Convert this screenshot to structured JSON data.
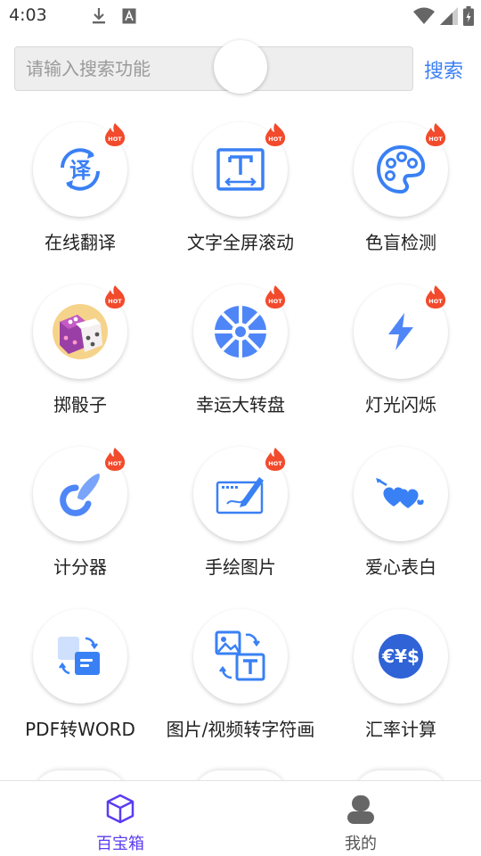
{
  "status": {
    "time": "4:03"
  },
  "search": {
    "placeholder": "请输入搜索功能",
    "button": "搜索"
  },
  "hot_badge": "HOT",
  "tools": [
    {
      "label": "在线翻译",
      "icon": "translate-icon",
      "hot": true
    },
    {
      "label": "文字全屏滚动",
      "icon": "text-frame-icon",
      "hot": true
    },
    {
      "label": "色盲检测",
      "icon": "palette-icon",
      "hot": true
    },
    {
      "label": "掷骰子",
      "icon": "dice-icon",
      "hot": true
    },
    {
      "label": "幸运大转盘",
      "icon": "wheel-icon",
      "hot": true
    },
    {
      "label": "灯光闪烁",
      "icon": "lightning-icon",
      "hot": true
    },
    {
      "label": "计分器",
      "icon": "score-icon",
      "hot": true
    },
    {
      "label": "手绘图片",
      "icon": "drawing-tablet-icon",
      "hot": true
    },
    {
      "label": "爱心表白",
      "icon": "hearts-icon",
      "hot": false
    },
    {
      "label": "PDF转WORD",
      "icon": "pdf-convert-icon",
      "hot": false
    },
    {
      "label": "图片/视频转字符画",
      "icon": "image-to-text-icon",
      "hot": false
    },
    {
      "label": "汇率计算",
      "icon": "currency-icon",
      "hot": false
    }
  ],
  "nav": [
    {
      "label": "百宝箱",
      "active": true,
      "icon": "cube-icon"
    },
    {
      "label": "我的",
      "active": false,
      "icon": "person-icon"
    }
  ],
  "colors": {
    "accent": "#3a80f5",
    "nav_active": "#5b3cf0",
    "nav_inactive": "#666666",
    "hot": "#f24a2c"
  }
}
